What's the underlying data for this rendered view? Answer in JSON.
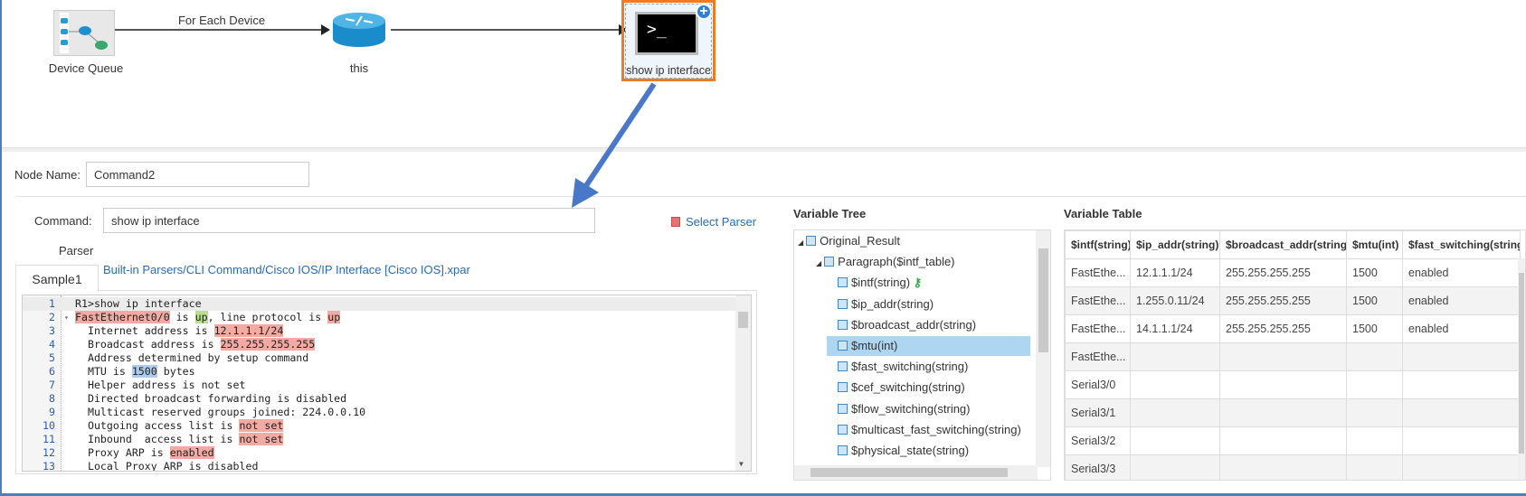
{
  "workflow": {
    "nodes": [
      {
        "label": "Device Queue",
        "icon": "device-queue-icon"
      },
      {
        "label": "this",
        "icon": "router-icon"
      },
      {
        "label": "show ip interface",
        "icon": "terminal-icon",
        "selected": true
      }
    ],
    "edges": [
      {
        "label": "For Each Device"
      },
      {
        "label": ""
      }
    ],
    "terminal_glyph": ">_",
    "add_glyph": "+"
  },
  "form": {
    "node_name_label": "Node Name:",
    "node_name_value": "Command2",
    "command_label": "Command:",
    "command_value": "show ip interface",
    "select_parser": "Select Parser",
    "parser_label": "Parser",
    "parser_path": "Built-in Parsers/CLI Command/Cisco IOS/IP Interface [Cisco IOS].xpar"
  },
  "sample_tab": "Sample1",
  "code_lines": [
    {
      "n": "1",
      "segs": [
        [
          "",
          "R1>show ip interface"
        ]
      ]
    },
    {
      "n": "2",
      "fold": true,
      "segs": [
        [
          "r",
          "FastEthernet0/0"
        ],
        [
          "",
          " is "
        ],
        [
          "g",
          "up"
        ],
        [
          "",
          ", line protocol is "
        ],
        [
          "r",
          "up"
        ]
      ]
    },
    {
      "n": "3",
      "segs": [
        [
          "",
          "  Internet address is "
        ],
        [
          "r",
          "12.1.1.1/24"
        ]
      ]
    },
    {
      "n": "4",
      "segs": [
        [
          "",
          "  Broadcast address is "
        ],
        [
          "r",
          "255.255.255.255"
        ]
      ]
    },
    {
      "n": "5",
      "segs": [
        [
          "",
          "  Address determined by setup command"
        ]
      ]
    },
    {
      "n": "6",
      "segs": [
        [
          "",
          "  MTU is "
        ],
        [
          "b",
          "1500"
        ],
        [
          "",
          " bytes"
        ]
      ]
    },
    {
      "n": "7",
      "segs": [
        [
          "",
          "  Helper address is not set"
        ]
      ]
    },
    {
      "n": "8",
      "segs": [
        [
          "",
          "  Directed broadcast forwarding is disabled"
        ]
      ]
    },
    {
      "n": "9",
      "segs": [
        [
          "",
          "  Multicast reserved groups joined: 224.0.0.10"
        ]
      ]
    },
    {
      "n": "10",
      "segs": [
        [
          "",
          "  Outgoing access list is "
        ],
        [
          "r",
          "not set"
        ]
      ]
    },
    {
      "n": "11",
      "segs": [
        [
          "",
          "  Inbound  access list is "
        ],
        [
          "r",
          "not set"
        ]
      ]
    },
    {
      "n": "12",
      "segs": [
        [
          "",
          "  Proxy ARP is "
        ],
        [
          "r",
          "enabled"
        ]
      ]
    },
    {
      "n": "13",
      "segs": [
        [
          "",
          "  Local Proxy ARP is disabled"
        ]
      ]
    }
  ],
  "variable_tree": {
    "title": "Variable Tree",
    "items": [
      {
        "label": "Original_Result",
        "level": 0,
        "expanded": true
      },
      {
        "label": "Paragraph($intf_table)",
        "level": 1,
        "expanded": true
      },
      {
        "label": "$intf(string)",
        "level": 2,
        "key": true
      },
      {
        "label": "$ip_addr(string)",
        "level": 2
      },
      {
        "label": "$broadcast_addr(string)",
        "level": 2
      },
      {
        "label": "$mtu(int)",
        "level": 2,
        "selected": true
      },
      {
        "label": "$fast_switching(string)",
        "level": 2
      },
      {
        "label": "$cef_switching(string)",
        "level": 2
      },
      {
        "label": "$flow_switching(string)",
        "level": 2
      },
      {
        "label": "$multicast_fast_switching(string)",
        "level": 2
      },
      {
        "label": "$physical_state(string)",
        "level": 2
      }
    ]
  },
  "variable_table": {
    "title": "Variable Table",
    "columns": [
      "$intf(string)",
      "$ip_addr(string)",
      "$broadcast_addr(string)",
      "$mtu(int)",
      "$fast_switching(string)"
    ],
    "rows": [
      [
        "FastEthe...",
        "12.1.1.1/24",
        "255.255.255.255",
        "1500",
        "enabled"
      ],
      [
        "FastEthe...",
        "1.255.0.11/24",
        "255.255.255.255",
        "1500",
        "enabled"
      ],
      [
        "FastEthe...",
        "14.1.1.1/24",
        "255.255.255.255",
        "1500",
        "enabled"
      ],
      [
        "FastEthe...",
        "",
        "",
        "",
        ""
      ],
      [
        "Serial3/0",
        "",
        "",
        "",
        ""
      ],
      [
        "Serial3/1",
        "",
        "",
        "",
        ""
      ],
      [
        "Serial3/2",
        "",
        "",
        "",
        ""
      ],
      [
        "Serial3/3",
        "",
        "",
        "",
        ""
      ]
    ]
  },
  "colors": {
    "selection_border": "#f07b22",
    "arrow": "#4a78c8",
    "highlight_red": "#f2aaa2",
    "highlight_green": "#b8e08e",
    "highlight_blue": "#aecbeb",
    "tree_selected": "#aed6f1"
  }
}
